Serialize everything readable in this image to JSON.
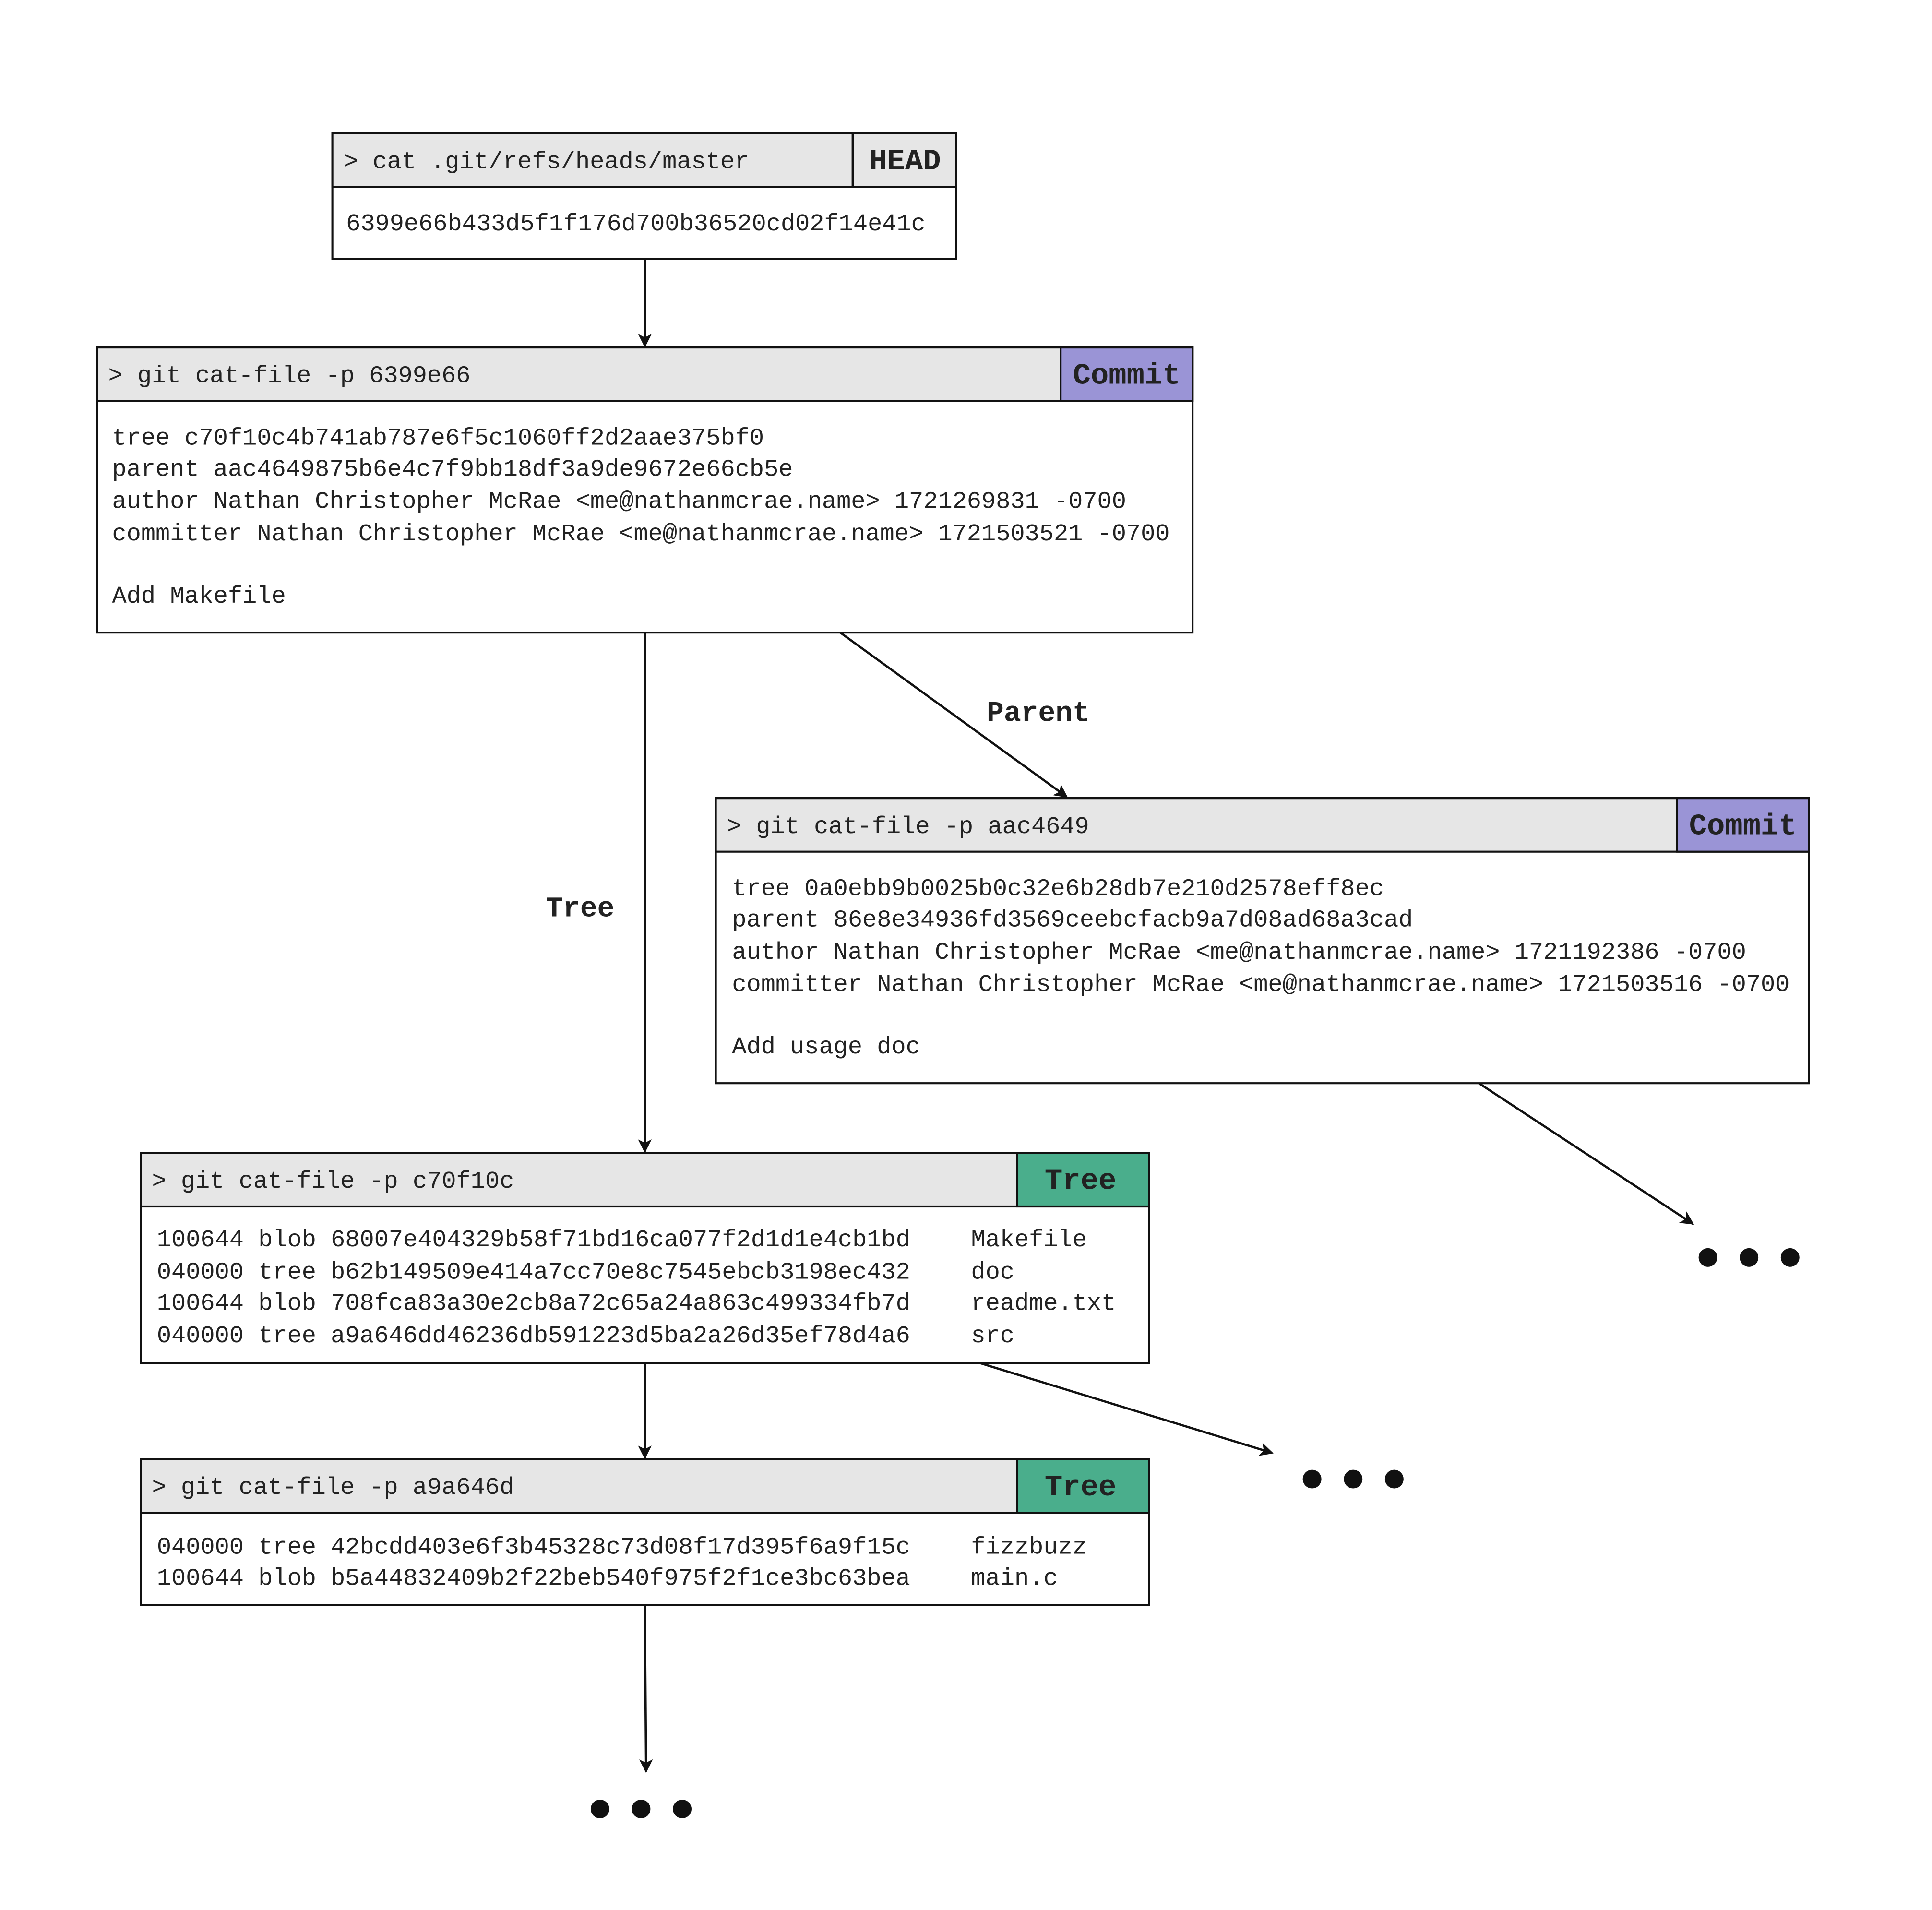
{
  "colors": {
    "header": "#e6e6e6",
    "commit": "#9a94d6",
    "tree": "#4aae8c",
    "line": "#111111"
  },
  "head": {
    "command": "> cat .git/refs/heads/master",
    "tag": "HEAD",
    "body": [
      "6399e66b433d5f1f176d700b36520cd02f14e41c"
    ]
  },
  "commit1": {
    "command": "> git cat-file -p 6399e66",
    "tag": "Commit",
    "body": [
      "tree c70f10c4b741ab787e6f5c1060ff2d2aae375bf0",
      "parent aac4649875b6e4c7f9bb18df3a9de9672e66cb5e",
      "author Nathan Christopher McRae <me@nathanmcrae.name> 1721269831 -0700",
      "committer Nathan Christopher McRae <me@nathanmcrae.name> 1721503521 -0700",
      "Add Makefile"
    ]
  },
  "commit2": {
    "command": "> git cat-file -p aac4649",
    "tag": "Commit",
    "body": [
      "tree 0a0ebb9b0025b0c32e6b28db7e210d2578eff8ec",
      "parent 86e8e34936fd3569ceebcfacb9a7d08ad68a3cad",
      "author Nathan Christopher McRae <me@nathanmcrae.name> 1721192386 -0700",
      "committer Nathan Christopher McRae <me@nathanmcrae.name> 1721503516 -0700",
      "Add usage doc"
    ]
  },
  "tree1": {
    "command": "> git cat-file -p c70f10c",
    "tag": "Tree",
    "entries": [
      {
        "entry": "100644 blob 68007e404329b58f71bd16ca077f2d1d1e4cb1bd",
        "name": "Makefile"
      },
      {
        "entry": "040000 tree b62b149509e414a7cc70e8c7545ebcb3198ec432",
        "name": "doc"
      },
      {
        "entry": "100644 blob 708fca83a30e2cb8a72c65a24a863c499334fb7d",
        "name": "readme.txt"
      },
      {
        "entry": "040000 tree a9a646dd46236db591223d5ba2a26d35ef78d4a6",
        "name": "src"
      }
    ]
  },
  "tree2": {
    "command": "> git cat-file -p a9a646d",
    "tag": "Tree",
    "entries": [
      {
        "entry": "040000 tree 42bcdd403e6f3b45328c73d08f17d395f6a9f15c",
        "name": "fizzbuzz"
      },
      {
        "entry": "100644 blob b5a44832409b2f22beb540f975f2f1ce3bc63bea",
        "name": "main.c"
      }
    ]
  },
  "edges": {
    "tree_label": "Tree",
    "parent_label": "Parent"
  }
}
